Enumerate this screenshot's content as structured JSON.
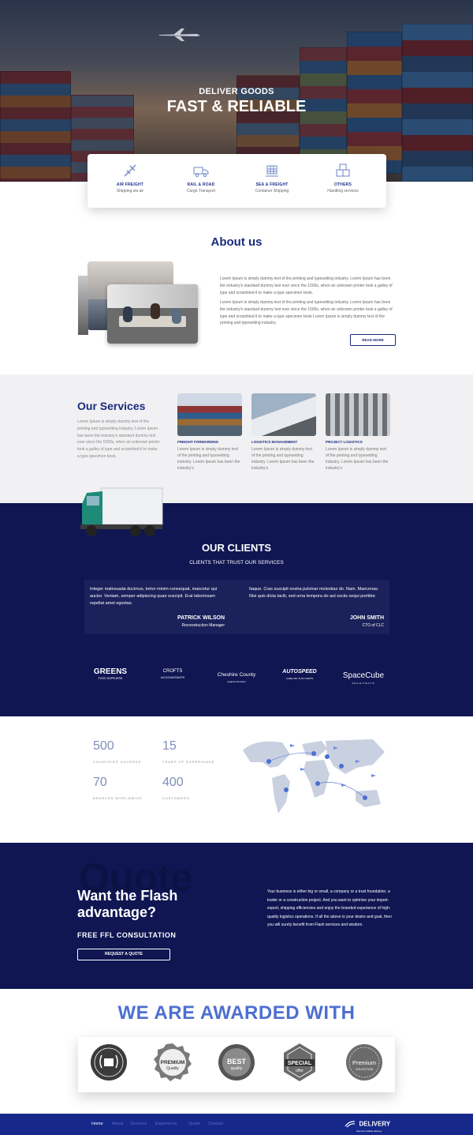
{
  "hero": {
    "subtitle": "DELIVER GOODS",
    "title": "FAST & RELIABLE"
  },
  "services_bar": [
    {
      "label": "AIR FREIGHT",
      "sub": "Shipping via air",
      "icon": "plane-icon"
    },
    {
      "label": "RAIL & ROAD",
      "sub": "Cargo Transport",
      "icon": "truck-icon"
    },
    {
      "label": "SEA & FREIGHT",
      "sub": "Container Shipping",
      "icon": "ship-icon"
    },
    {
      "label": "OTHERS",
      "sub": "Handling services",
      "icon": "boxes-icon"
    }
  ],
  "about": {
    "title": "About us",
    "p1": "Lorem Ipsum is simply dummy text of the printing and typesetting industry. Lorem Ipsum has been the industry's standard dummy text ever since the 1500s, when an unknown printer took a galley of type and scrambled it to make a type specimen book.",
    "p2": "Lorem Ipsum is simply dummy text of the printing and typesetting industry. Lorem Ipsum has been the industry's standard dummy text ever since the 1500s, when an unknown printer took a galley of type and scrambled it to make a type specimen book Lorem Ipsum is simply dummy text of the printing and typesetting industry.",
    "button": "READ MORE"
  },
  "our_services": {
    "title": "Our Services",
    "text": "Lorem Ipsum is simply dummy text of the printing and typesetting industry. Lorem Ipsum has been the industry's standard dummy text ever since the 1500s, when an unknown printer took a galley of type and scrambled it to make a type specimen book.",
    "cards": [
      {
        "title": "FREIGHT FORWARDING",
        "text": "Lorem Ipsum is simply dummy text of the printing and typesetting industry. Lorem Ipsum has been the industry's"
      },
      {
        "title": "LOGISTICS MANAGEMENT",
        "text": "Lorem Ipsum is simply dummy text of the printing and typesetting industry. Lorem Ipsum has been the industry's"
      },
      {
        "title": "PROJECT LOGISTICS",
        "text": "Lorem Ipsum is simply dummy text of the printing and typesetting industry. Lorem Ipsum has been the industry's"
      }
    ]
  },
  "clients": {
    "title": "OUR CLIENTS",
    "subtitle": "CLIENTS THAT TRUST OUR SERVICES",
    "testimonials": [
      {
        "quote": "Integer malesuada ducimus, tortor minim consequat, mascetur qui auctor. Veniam, semper adipiscing quae suscipit. Erat laboriosam repellat amet egestas.",
        "name": "PATRICK WILSON",
        "role": "Reconstruction Manager"
      },
      {
        "quote": "Itaque. Cras suscipit nostra pulvinar molestias do. Nam. Maecenas. Nisi quis dicta taciti, sed urna tempora do aut sociis sequi porttitor.",
        "name": "JOHN SMITH",
        "role": "CTO of CLC"
      }
    ],
    "logos": [
      {
        "name": "GREENS",
        "sub": "FOOD SUPPLIERS"
      },
      {
        "name": "CROFTS",
        "sub": "ACCOUNTANTS"
      },
      {
        "name": "Cheshire County",
        "sub": "Hygiene Services"
      },
      {
        "name": "AUTOSPEED",
        "sub": "CARE ANY AUTO PARTS"
      },
      {
        "name": "SpaceCube",
        "sub": "ARCHITECTS"
      }
    ]
  },
  "stats": [
    {
      "value": "500",
      "label": "COUNTRIES COVERED"
    },
    {
      "value": "15",
      "label": "YEARS OF EXPERIENCE"
    },
    {
      "value": "70",
      "label": "BRANCES WORLDWIDE"
    },
    {
      "value": "400",
      "label": "CUSTOMERS"
    }
  ],
  "cta": {
    "bg_word": "Quote",
    "title": "Want the Flash advantage?",
    "subtitle": "FREE FFL CONSULTATION",
    "button": "REQUEST A QUOTE",
    "text": "Your business is either big or small, a company or a trust foundation, a trader or a construction project. And you want to optimize your import-export, shipping efficiencies and enjoy the branded experience of high-quality logistics operations. If all the above is your desire and goal, then you will surely benefit from Flash services and wisdom."
  },
  "awards": {
    "title": "WE ARE AWARDED WITH",
    "badges": [
      {
        "top": "",
        "main": "",
        "bottom": ""
      },
      {
        "top": "",
        "main": "PREMIUM",
        "bottom": "Quality"
      },
      {
        "top": "",
        "main": "BEST",
        "bottom": "quality"
      },
      {
        "top": "",
        "main": "SPECIAL",
        "bottom": "offer"
      },
      {
        "top": "",
        "main": "Premium",
        "bottom": "COLLECTION"
      }
    ]
  },
  "footer": {
    "nav": [
      "Home",
      "About",
      "Services",
      "Experience",
      "Quote",
      "Contact"
    ],
    "brand": "DELIVERY",
    "brand_sub": "fast and reliable delivery"
  }
}
